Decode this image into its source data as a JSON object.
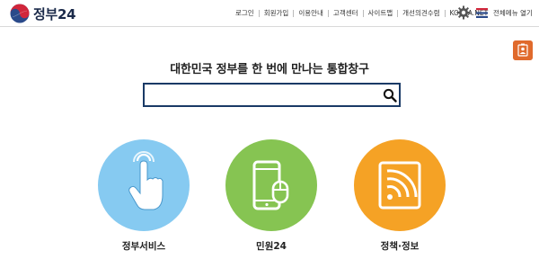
{
  "brand": {
    "name": "정부24"
  },
  "header": {
    "nav": [
      "로그인",
      "회원가입",
      "이용안내",
      "고객센터",
      "사이트맵",
      "개선의견수렴",
      "KOREA.NET"
    ],
    "menu_label": "전체메뉴 열기"
  },
  "hero": {
    "title": "대한민국 정부를 한 번에 만나는 통합창구",
    "search_value": "",
    "search_placeholder": ""
  },
  "services": [
    {
      "label": "정부서비스",
      "icon": "touch-hand-icon",
      "color": "#86caf1"
    },
    {
      "label": "민원24",
      "icon": "mobile-mouse-icon",
      "color": "#86c452"
    },
    {
      "label": "정책·정보",
      "icon": "rss-tablet-icon",
      "color": "#f5a225"
    }
  ],
  "colors": {
    "accent": "#1a3a66",
    "badge": "#e06a2c"
  }
}
